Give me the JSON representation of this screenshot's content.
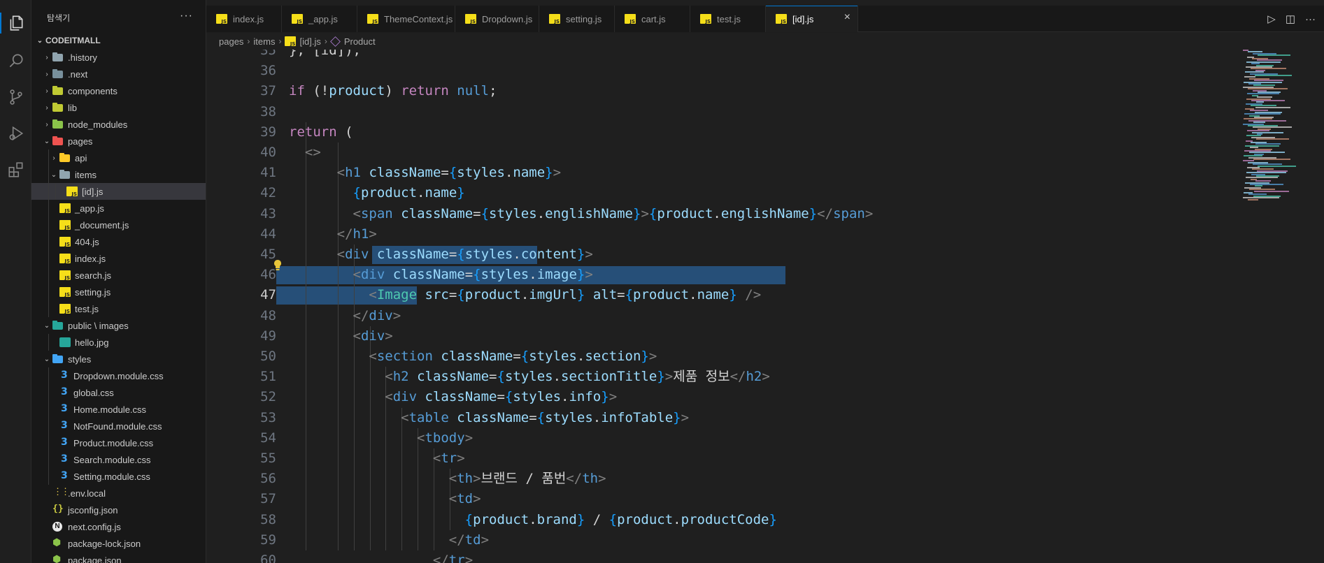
{
  "explorer": {
    "title": "탐색기",
    "more_label": "···",
    "root": "CODEITMALL",
    "items": [
      {
        "label": ".history",
        "kind": "folder",
        "color": "#90a4ae",
        "depth": 0,
        "chev": "›"
      },
      {
        "label": ".next",
        "kind": "folder",
        "color": "#78909c",
        "depth": 0,
        "chev": "›"
      },
      {
        "label": "components",
        "kind": "folder",
        "color": "#c0ca33",
        "depth": 0,
        "chev": "›"
      },
      {
        "label": "lib",
        "kind": "folder",
        "color": "#c0ca33",
        "depth": 0,
        "chev": "›"
      },
      {
        "label": "node_modules",
        "kind": "folder",
        "color": "#8bc34a",
        "depth": 0,
        "chev": "›"
      },
      {
        "label": "pages",
        "kind": "folder",
        "color": "#ef5350",
        "depth": 0,
        "chev": "⌄"
      },
      {
        "label": "api",
        "kind": "folder",
        "color": "#ffca28",
        "depth": 1,
        "chev": "›"
      },
      {
        "label": "items",
        "kind": "folder",
        "color": "#90a4ae",
        "depth": 1,
        "chev": "⌄"
      },
      {
        "label": "[id].js",
        "kind": "js",
        "depth": 2,
        "chev": "",
        "selected": true
      },
      {
        "label": "_app.js",
        "kind": "js",
        "depth": 1,
        "chev": ""
      },
      {
        "label": "_document.js",
        "kind": "js",
        "depth": 1,
        "chev": ""
      },
      {
        "label": "404.js",
        "kind": "js",
        "depth": 1,
        "chev": ""
      },
      {
        "label": "index.js",
        "kind": "js",
        "depth": 1,
        "chev": ""
      },
      {
        "label": "search.js",
        "kind": "js",
        "depth": 1,
        "chev": ""
      },
      {
        "label": "setting.js",
        "kind": "js",
        "depth": 1,
        "chev": ""
      },
      {
        "label": "test.js",
        "kind": "js",
        "depth": 1,
        "chev": ""
      },
      {
        "label": "public \\ images",
        "kind": "folder",
        "color": "#26a69a",
        "depth": 0,
        "chev": "⌄"
      },
      {
        "label": "hello.jpg",
        "kind": "img",
        "depth": 1,
        "chev": ""
      },
      {
        "label": "styles",
        "kind": "folder",
        "color": "#42a5f5",
        "depth": 0,
        "chev": "⌄"
      },
      {
        "label": "Dropdown.module.css",
        "kind": "css",
        "depth": 1,
        "chev": ""
      },
      {
        "label": "global.css",
        "kind": "css",
        "depth": 1,
        "chev": ""
      },
      {
        "label": "Home.module.css",
        "kind": "css",
        "depth": 1,
        "chev": ""
      },
      {
        "label": "NotFound.module.css",
        "kind": "css",
        "depth": 1,
        "chev": ""
      },
      {
        "label": "Product.module.css",
        "kind": "css",
        "depth": 1,
        "chev": ""
      },
      {
        "label": "Search.module.css",
        "kind": "css",
        "depth": 1,
        "chev": ""
      },
      {
        "label": "Setting.module.css",
        "kind": "css",
        "depth": 1,
        "chev": ""
      },
      {
        "label": ".env.local",
        "kind": "env",
        "depth": 0,
        "chev": ""
      },
      {
        "label": "jsconfig.json",
        "kind": "json",
        "depth": 0,
        "chev": ""
      },
      {
        "label": "next.config.js",
        "kind": "next",
        "depth": 0,
        "chev": ""
      },
      {
        "label": "package-lock.json",
        "kind": "pkg",
        "depth": 0,
        "chev": ""
      },
      {
        "label": "package.json",
        "kind": "pkg",
        "depth": 0,
        "chev": ""
      }
    ]
  },
  "tabs": [
    {
      "label": "index.js",
      "active": false
    },
    {
      "label": "_app.js",
      "active": false
    },
    {
      "label": "ThemeContext.js",
      "active": false
    },
    {
      "label": "Dropdown.js",
      "active": false
    },
    {
      "label": "setting.js",
      "active": false
    },
    {
      "label": "cart.js",
      "active": false
    },
    {
      "label": "test.js",
      "active": false
    },
    {
      "label": "[id].js",
      "active": true
    }
  ],
  "tab_close_icon": "×",
  "breadcrumb": [
    "pages",
    "items",
    "[id].js",
    "Product"
  ],
  "editor": {
    "first_line": 35,
    "current_line": 47,
    "lines": [
      [
        [
          "}, [id]);",
          "w"
        ]
      ],
      [
        [
          "",
          "w"
        ]
      ],
      [
        [
          "if",
          "k"
        ],
        [
          " (",
          "w"
        ],
        [
          "!",
          "w"
        ],
        [
          "product",
          "v"
        ],
        [
          ") ",
          "w"
        ],
        [
          "return",
          "k"
        ],
        [
          " ",
          "w"
        ],
        [
          "null",
          "t"
        ],
        [
          ";",
          "w"
        ]
      ],
      [
        [
          "",
          "w"
        ]
      ],
      [
        [
          "return",
          "k"
        ],
        [
          " (",
          "w"
        ]
      ],
      [
        [
          "  ",
          "w"
        ],
        [
          "<>",
          "p"
        ]
      ],
      [
        [
          "      ",
          "w"
        ],
        [
          "<",
          "p"
        ],
        [
          "h1",
          "t"
        ],
        [
          " ",
          "w"
        ],
        [
          "className",
          "v"
        ],
        [
          "=",
          "w"
        ],
        [
          "{",
          "b"
        ],
        [
          "styles",
          "v"
        ],
        [
          ".",
          "w"
        ],
        [
          "name",
          "v"
        ],
        [
          "}",
          "b"
        ],
        [
          ">",
          "p"
        ]
      ],
      [
        [
          "        ",
          "w"
        ],
        [
          "{",
          "b"
        ],
        [
          "product",
          "v"
        ],
        [
          ".",
          "w"
        ],
        [
          "name",
          "v"
        ],
        [
          "}",
          "b"
        ]
      ],
      [
        [
          "        ",
          "w"
        ],
        [
          "<",
          "p"
        ],
        [
          "span",
          "t"
        ],
        [
          " ",
          "w"
        ],
        [
          "className",
          "v"
        ],
        [
          "=",
          "w"
        ],
        [
          "{",
          "b"
        ],
        [
          "styles",
          "v"
        ],
        [
          ".",
          "w"
        ],
        [
          "englishName",
          "v"
        ],
        [
          "}",
          "b"
        ],
        [
          ">",
          "p"
        ],
        [
          "{",
          "b"
        ],
        [
          "product",
          "v"
        ],
        [
          ".",
          "w"
        ],
        [
          "englishName",
          "v"
        ],
        [
          "}",
          "b"
        ],
        [
          "</",
          "p"
        ],
        [
          "span",
          "t"
        ],
        [
          ">",
          "p"
        ]
      ],
      [
        [
          "      ",
          "w"
        ],
        [
          "</",
          "p"
        ],
        [
          "h1",
          "t"
        ],
        [
          ">",
          "p"
        ]
      ],
      [
        [
          "      ",
          "w"
        ],
        [
          "<",
          "p"
        ],
        [
          "div",
          "t"
        ],
        [
          " ",
          "w"
        ],
        [
          "className",
          "v"
        ],
        [
          "=",
          "w"
        ],
        [
          "{",
          "b"
        ],
        [
          "styles",
          "v"
        ],
        [
          ".",
          "w"
        ],
        [
          "content",
          "v"
        ],
        [
          "}",
          "b"
        ],
        [
          ">",
          "p"
        ]
      ],
      [
        [
          "        ",
          "w"
        ],
        [
          "<",
          "p"
        ],
        [
          "div",
          "t"
        ],
        [
          " ",
          "w"
        ],
        [
          "className",
          "v"
        ],
        [
          "=",
          "w"
        ],
        [
          "{",
          "b"
        ],
        [
          "styles",
          "v"
        ],
        [
          ".",
          "w"
        ],
        [
          "image",
          "v"
        ],
        [
          "}",
          "b"
        ],
        [
          ">",
          "p"
        ]
      ],
      [
        [
          "          ",
          "w"
        ],
        [
          "<",
          "p"
        ],
        [
          "Image",
          "c"
        ],
        [
          " ",
          "w"
        ],
        [
          "src",
          "v"
        ],
        [
          "=",
          "w"
        ],
        [
          "{",
          "b"
        ],
        [
          "product",
          "v"
        ],
        [
          ".",
          "w"
        ],
        [
          "imgUrl",
          "v"
        ],
        [
          "}",
          "b"
        ],
        [
          " ",
          "w"
        ],
        [
          "alt",
          "v"
        ],
        [
          "=",
          "w"
        ],
        [
          "{",
          "b"
        ],
        [
          "product",
          "v"
        ],
        [
          ".",
          "w"
        ],
        [
          "name",
          "v"
        ],
        [
          "}",
          "b"
        ],
        [
          " ",
          "w"
        ],
        [
          "/>",
          "p"
        ]
      ],
      [
        [
          "        ",
          "w"
        ],
        [
          "</",
          "p"
        ],
        [
          "div",
          "t"
        ],
        [
          ">",
          "p"
        ]
      ],
      [
        [
          "        ",
          "w"
        ],
        [
          "<",
          "p"
        ],
        [
          "div",
          "t"
        ],
        [
          ">",
          "p"
        ]
      ],
      [
        [
          "          ",
          "w"
        ],
        [
          "<",
          "p"
        ],
        [
          "section",
          "t"
        ],
        [
          " ",
          "w"
        ],
        [
          "className",
          "v"
        ],
        [
          "=",
          "w"
        ],
        [
          "{",
          "b"
        ],
        [
          "styles",
          "v"
        ],
        [
          ".",
          "w"
        ],
        [
          "section",
          "v"
        ],
        [
          "}",
          "b"
        ],
        [
          ">",
          "p"
        ]
      ],
      [
        [
          "            ",
          "w"
        ],
        [
          "<",
          "p"
        ],
        [
          "h2",
          "t"
        ],
        [
          " ",
          "w"
        ],
        [
          "className",
          "v"
        ],
        [
          "=",
          "w"
        ],
        [
          "{",
          "b"
        ],
        [
          "styles",
          "v"
        ],
        [
          ".",
          "w"
        ],
        [
          "sectionTitle",
          "v"
        ],
        [
          "}",
          "b"
        ],
        [
          ">",
          "p"
        ],
        [
          "제품 정보",
          "w"
        ],
        [
          "</",
          "p"
        ],
        [
          "h2",
          "t"
        ],
        [
          ">",
          "p"
        ]
      ],
      [
        [
          "            ",
          "w"
        ],
        [
          "<",
          "p"
        ],
        [
          "div",
          "t"
        ],
        [
          " ",
          "w"
        ],
        [
          "className",
          "v"
        ],
        [
          "=",
          "w"
        ],
        [
          "{",
          "b"
        ],
        [
          "styles",
          "v"
        ],
        [
          ".",
          "w"
        ],
        [
          "info",
          "v"
        ],
        [
          "}",
          "b"
        ],
        [
          ">",
          "p"
        ]
      ],
      [
        [
          "              ",
          "w"
        ],
        [
          "<",
          "p"
        ],
        [
          "table",
          "t"
        ],
        [
          " ",
          "w"
        ],
        [
          "className",
          "v"
        ],
        [
          "=",
          "w"
        ],
        [
          "{",
          "b"
        ],
        [
          "styles",
          "v"
        ],
        [
          ".",
          "w"
        ],
        [
          "infoTable",
          "v"
        ],
        [
          "}",
          "b"
        ],
        [
          ">",
          "p"
        ]
      ],
      [
        [
          "                ",
          "w"
        ],
        [
          "<",
          "p"
        ],
        [
          "tbody",
          "t"
        ],
        [
          ">",
          "p"
        ]
      ],
      [
        [
          "                  ",
          "w"
        ],
        [
          "<",
          "p"
        ],
        [
          "tr",
          "t"
        ],
        [
          ">",
          "p"
        ]
      ],
      [
        [
          "                    ",
          "w"
        ],
        [
          "<",
          "p"
        ],
        [
          "th",
          "t"
        ],
        [
          ">",
          "p"
        ],
        [
          "브랜드 / 품번",
          "w"
        ],
        [
          "</",
          "p"
        ],
        [
          "th",
          "t"
        ],
        [
          ">",
          "p"
        ]
      ],
      [
        [
          "                    ",
          "w"
        ],
        [
          "<",
          "p"
        ],
        [
          "td",
          "t"
        ],
        [
          ">",
          "p"
        ]
      ],
      [
        [
          "                      ",
          "w"
        ],
        [
          "{",
          "b"
        ],
        [
          "product",
          "v"
        ],
        [
          ".",
          "w"
        ],
        [
          "brand",
          "v"
        ],
        [
          "}",
          "b"
        ],
        [
          " / ",
          "w"
        ],
        [
          "{",
          "b"
        ],
        [
          "product",
          "v"
        ],
        [
          ".",
          "w"
        ],
        [
          "productCode",
          "v"
        ],
        [
          "}",
          "b"
        ]
      ],
      [
        [
          "                    ",
          "w"
        ],
        [
          "</",
          "p"
        ],
        [
          "td",
          "t"
        ],
        [
          ">",
          "p"
        ]
      ],
      [
        [
          "                  ",
          "w"
        ],
        [
          "</",
          "p"
        ],
        [
          "tr",
          "t"
        ],
        [
          ">",
          "p"
        ]
      ]
    ]
  },
  "icons": {
    "explorer": "files-icon",
    "search": "search-icon",
    "scm": "source-control-icon",
    "debug": "run-debug-icon",
    "extensions": "extensions-icon",
    "run": "run-icon",
    "split": "split-editor-icon",
    "lightbulb": "lightbulb-icon"
  },
  "colors": {
    "selection": "#264f78",
    "accent": "#0078d4"
  }
}
